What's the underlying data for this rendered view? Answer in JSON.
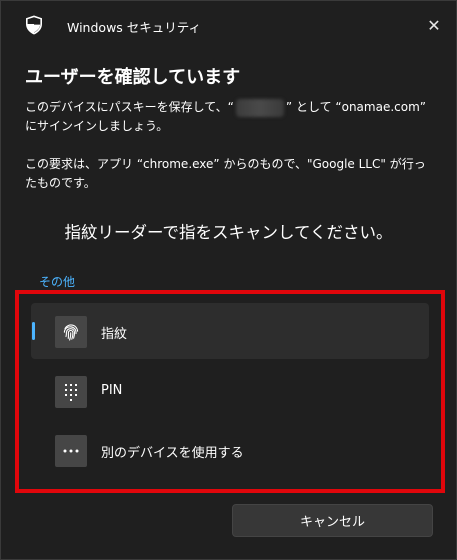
{
  "window": {
    "app_title": "Windows セキュリティ",
    "close_glyph": "✕"
  },
  "dialog": {
    "heading": "ユーザーを確認しています",
    "message1_prefix": "このデバイスにパスキーを保存して、“",
    "message1_suffix": "” として “onamae.com” にサインインしましょう。",
    "message2": "この要求は、アプリ “chrome.exe” からのもので、\"Google LLC\" が行ったものです。",
    "instruction": "指紋リーダーで指をスキャンしてください。",
    "more_choices": "その他"
  },
  "options": [
    {
      "label": "指紋",
      "icon": "fingerprint-icon",
      "selected": true
    },
    {
      "label": "PIN",
      "icon": "keypad-icon",
      "selected": false
    },
    {
      "label": "別のデバイスを使用する",
      "icon": "more-dots-icon",
      "selected": false
    }
  ],
  "buttons": {
    "cancel": "キャンセル"
  },
  "colors": {
    "background": "#1f1f1f",
    "accent": "#4cb4ff",
    "highlight_box": "#e0060b",
    "tile": "#464646"
  }
}
